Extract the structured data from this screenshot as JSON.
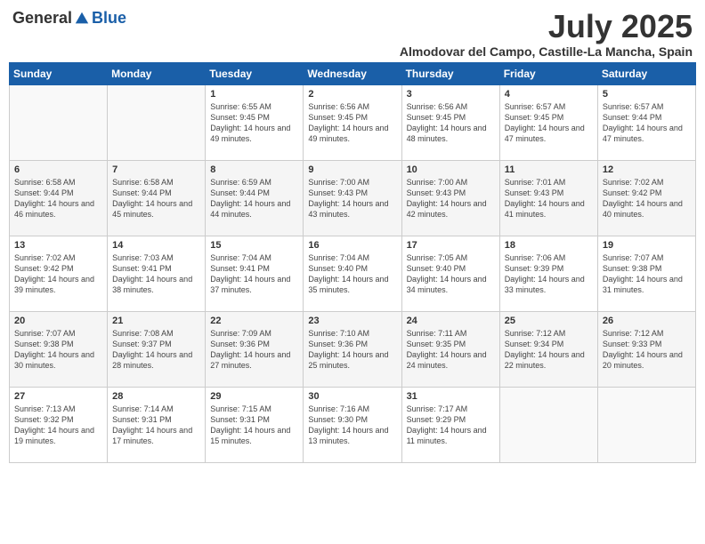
{
  "header": {
    "logo_general": "General",
    "logo_blue": "Blue",
    "month": "July 2025",
    "location": "Almodovar del Campo, Castille-La Mancha, Spain"
  },
  "weekdays": [
    "Sunday",
    "Monday",
    "Tuesday",
    "Wednesday",
    "Thursday",
    "Friday",
    "Saturday"
  ],
  "weeks": [
    [
      {
        "day": "",
        "info": ""
      },
      {
        "day": "",
        "info": ""
      },
      {
        "day": "1",
        "info": "Sunrise: 6:55 AM\nSunset: 9:45 PM\nDaylight: 14 hours and 49 minutes."
      },
      {
        "day": "2",
        "info": "Sunrise: 6:56 AM\nSunset: 9:45 PM\nDaylight: 14 hours and 49 minutes."
      },
      {
        "day": "3",
        "info": "Sunrise: 6:56 AM\nSunset: 9:45 PM\nDaylight: 14 hours and 48 minutes."
      },
      {
        "day": "4",
        "info": "Sunrise: 6:57 AM\nSunset: 9:45 PM\nDaylight: 14 hours and 47 minutes."
      },
      {
        "day": "5",
        "info": "Sunrise: 6:57 AM\nSunset: 9:44 PM\nDaylight: 14 hours and 47 minutes."
      }
    ],
    [
      {
        "day": "6",
        "info": "Sunrise: 6:58 AM\nSunset: 9:44 PM\nDaylight: 14 hours and 46 minutes."
      },
      {
        "day": "7",
        "info": "Sunrise: 6:58 AM\nSunset: 9:44 PM\nDaylight: 14 hours and 45 minutes."
      },
      {
        "day": "8",
        "info": "Sunrise: 6:59 AM\nSunset: 9:44 PM\nDaylight: 14 hours and 44 minutes."
      },
      {
        "day": "9",
        "info": "Sunrise: 7:00 AM\nSunset: 9:43 PM\nDaylight: 14 hours and 43 minutes."
      },
      {
        "day": "10",
        "info": "Sunrise: 7:00 AM\nSunset: 9:43 PM\nDaylight: 14 hours and 42 minutes."
      },
      {
        "day": "11",
        "info": "Sunrise: 7:01 AM\nSunset: 9:43 PM\nDaylight: 14 hours and 41 minutes."
      },
      {
        "day": "12",
        "info": "Sunrise: 7:02 AM\nSunset: 9:42 PM\nDaylight: 14 hours and 40 minutes."
      }
    ],
    [
      {
        "day": "13",
        "info": "Sunrise: 7:02 AM\nSunset: 9:42 PM\nDaylight: 14 hours and 39 minutes."
      },
      {
        "day": "14",
        "info": "Sunrise: 7:03 AM\nSunset: 9:41 PM\nDaylight: 14 hours and 38 minutes."
      },
      {
        "day": "15",
        "info": "Sunrise: 7:04 AM\nSunset: 9:41 PM\nDaylight: 14 hours and 37 minutes."
      },
      {
        "day": "16",
        "info": "Sunrise: 7:04 AM\nSunset: 9:40 PM\nDaylight: 14 hours and 35 minutes."
      },
      {
        "day": "17",
        "info": "Sunrise: 7:05 AM\nSunset: 9:40 PM\nDaylight: 14 hours and 34 minutes."
      },
      {
        "day": "18",
        "info": "Sunrise: 7:06 AM\nSunset: 9:39 PM\nDaylight: 14 hours and 33 minutes."
      },
      {
        "day": "19",
        "info": "Sunrise: 7:07 AM\nSunset: 9:38 PM\nDaylight: 14 hours and 31 minutes."
      }
    ],
    [
      {
        "day": "20",
        "info": "Sunrise: 7:07 AM\nSunset: 9:38 PM\nDaylight: 14 hours and 30 minutes."
      },
      {
        "day": "21",
        "info": "Sunrise: 7:08 AM\nSunset: 9:37 PM\nDaylight: 14 hours and 28 minutes."
      },
      {
        "day": "22",
        "info": "Sunrise: 7:09 AM\nSunset: 9:36 PM\nDaylight: 14 hours and 27 minutes."
      },
      {
        "day": "23",
        "info": "Sunrise: 7:10 AM\nSunset: 9:36 PM\nDaylight: 14 hours and 25 minutes."
      },
      {
        "day": "24",
        "info": "Sunrise: 7:11 AM\nSunset: 9:35 PM\nDaylight: 14 hours and 24 minutes."
      },
      {
        "day": "25",
        "info": "Sunrise: 7:12 AM\nSunset: 9:34 PM\nDaylight: 14 hours and 22 minutes."
      },
      {
        "day": "26",
        "info": "Sunrise: 7:12 AM\nSunset: 9:33 PM\nDaylight: 14 hours and 20 minutes."
      }
    ],
    [
      {
        "day": "27",
        "info": "Sunrise: 7:13 AM\nSunset: 9:32 PM\nDaylight: 14 hours and 19 minutes."
      },
      {
        "day": "28",
        "info": "Sunrise: 7:14 AM\nSunset: 9:31 PM\nDaylight: 14 hours and 17 minutes."
      },
      {
        "day": "29",
        "info": "Sunrise: 7:15 AM\nSunset: 9:31 PM\nDaylight: 14 hours and 15 minutes."
      },
      {
        "day": "30",
        "info": "Sunrise: 7:16 AM\nSunset: 9:30 PM\nDaylight: 14 hours and 13 minutes."
      },
      {
        "day": "31",
        "info": "Sunrise: 7:17 AM\nSunset: 9:29 PM\nDaylight: 14 hours and 11 minutes."
      },
      {
        "day": "",
        "info": ""
      },
      {
        "day": "",
        "info": ""
      }
    ]
  ]
}
